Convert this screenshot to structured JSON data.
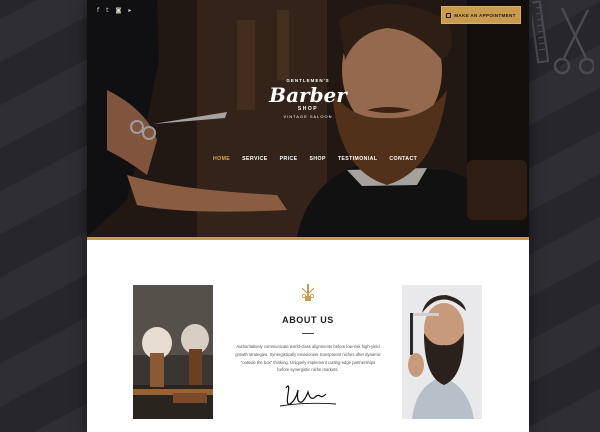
{
  "social": {
    "icons": [
      "facebook-icon",
      "twitter-icon",
      "instagram-icon",
      "youtube-icon"
    ],
    "glyphs": [
      "f",
      "t",
      "◙",
      "▸"
    ]
  },
  "cta": {
    "label": "MAKE AN APPOINTMENT"
  },
  "logo": {
    "top": "GENTLEMEN'S",
    "main": "Barber",
    "shop": "SHOP",
    "bottom": "VINTAGE SALOON"
  },
  "nav": {
    "items": [
      "HOME",
      "SERVICE",
      "PRICE",
      "SHOP",
      "TESTIMONIAL",
      "CONTACT"
    ],
    "active_index": 0
  },
  "about": {
    "title": "ABOUT US",
    "text": "Authoritatively communicate world-class alignments before low-risk high-yield growth strategies. Synergistically envisioneer transparent niches after dynamic \"outside the box\" thinking. Uniquely implement cutting-edge partnerships before synergistic niche markets."
  },
  "colors": {
    "accent": "#c99b4e",
    "active_nav": "#d9a85a",
    "background": "#2b2b30"
  }
}
